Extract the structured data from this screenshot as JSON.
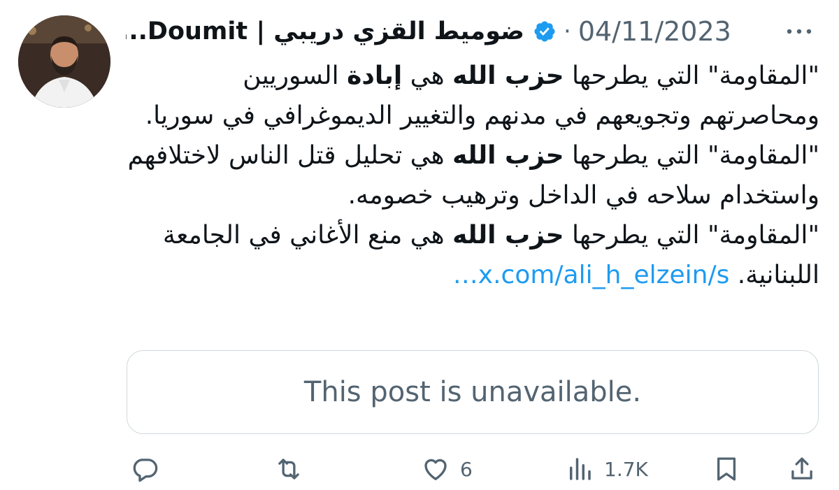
{
  "post": {
    "author_name": "ضوميط القزي دريبي | Doumit...",
    "separator": "·",
    "date": "04/11/2023",
    "body_segments": [
      {
        "text": "\"المقاومة\" التي يطرحها ",
        "bold": false
      },
      {
        "text": "حزب الله",
        "bold": true
      },
      {
        "text": " هي ",
        "bold": false
      },
      {
        "text": "إبادة",
        "bold": true
      },
      {
        "text": " السوريين ومحاصرتهم وتجويعهم في مدنهم والتغيير الديموغرافي في سوريا.",
        "bold": false
      },
      {
        "text": "\n",
        "bold": false
      },
      {
        "text": "\"المقاومة\" التي يطرحها ",
        "bold": false
      },
      {
        "text": "حزب الله",
        "bold": true
      },
      {
        "text": " هي تحليل قتل الناس لاختلافهم واستخدام سلاحه في الداخل وترهيب خصومه.",
        "bold": false
      },
      {
        "text": "\n",
        "bold": false
      },
      {
        "text": "\"المقاومة\" التي يطرحها ",
        "bold": false
      },
      {
        "text": "حزب الله",
        "bold": true
      },
      {
        "text": " هي منع الأغاني في الجامعة اللبنانية. ",
        "bold": false
      }
    ],
    "link_text": "x.com/ali_h_elzein/s…",
    "quoted_post_text": "This post is unavailable."
  },
  "actions": {
    "reply": {
      "icon": "reply-icon",
      "count": ""
    },
    "repost": {
      "icon": "repost-icon",
      "count": ""
    },
    "like": {
      "icon": "heart-icon",
      "count": "6"
    },
    "views": {
      "icon": "views-icon",
      "count": "1.7K"
    },
    "bookmark": {
      "icon": "bookmark-icon",
      "count": ""
    },
    "share": {
      "icon": "share-icon",
      "count": ""
    }
  },
  "colors": {
    "text": "#0f1419",
    "secondary": "#536471",
    "link": "#1d9bf0",
    "verified": "#1d9bf0",
    "border": "#cfd9de"
  }
}
